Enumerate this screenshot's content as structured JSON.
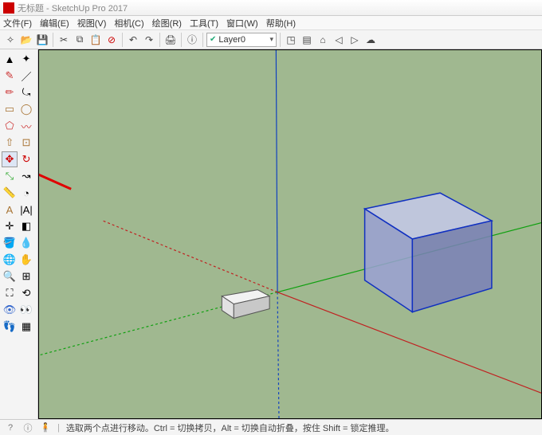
{
  "window": {
    "title": "无标题 - SketchUp Pro 2017"
  },
  "menus": [
    "文件(F)",
    "编辑(E)",
    "视图(V)",
    "相机(C)",
    "绘图(R)",
    "工具(T)",
    "窗口(W)",
    "帮助(H)"
  ],
  "layer": {
    "current": "Layer0"
  },
  "status": {
    "hint": "选取两个点进行移动。Ctrl = 切换拷贝，Alt = 切换自动折叠，按住 Shift = 锁定推理。"
  },
  "tools": {
    "row1": [
      "select",
      "lasso"
    ],
    "row2": [
      "eraser",
      "line"
    ],
    "row3": [
      "pencil",
      "arc"
    ],
    "row4": [
      "rectangle",
      "circle"
    ],
    "row5": [
      "polygon",
      "freehand"
    ],
    "row6": [
      "pushpull",
      "offset"
    ],
    "row7": [
      "move",
      "rotate"
    ],
    "row8": [
      "scale",
      "followme"
    ],
    "row9": [
      "tape",
      "protractor"
    ],
    "row10": [
      "text",
      "dimension"
    ],
    "row11": [
      "axes",
      "sectionplane"
    ],
    "row12": [
      "paint",
      "sample"
    ],
    "row13": [
      "orbit",
      "pan"
    ],
    "row14": [
      "zoom",
      "zoomwindow"
    ],
    "row15": [
      "zoomextents",
      "previous"
    ],
    "row16": [
      "position",
      "look"
    ],
    "row17": [
      "walk",
      "section"
    ]
  },
  "topbar_icons": [
    "new",
    "open",
    "save",
    "cut",
    "copy",
    "paste",
    "delete",
    "undo",
    "redo",
    "print",
    "model-info"
  ],
  "topbar_icons2": [
    "component",
    "outliner",
    "house",
    "prev-scene",
    "next-scene",
    "warehouse"
  ]
}
